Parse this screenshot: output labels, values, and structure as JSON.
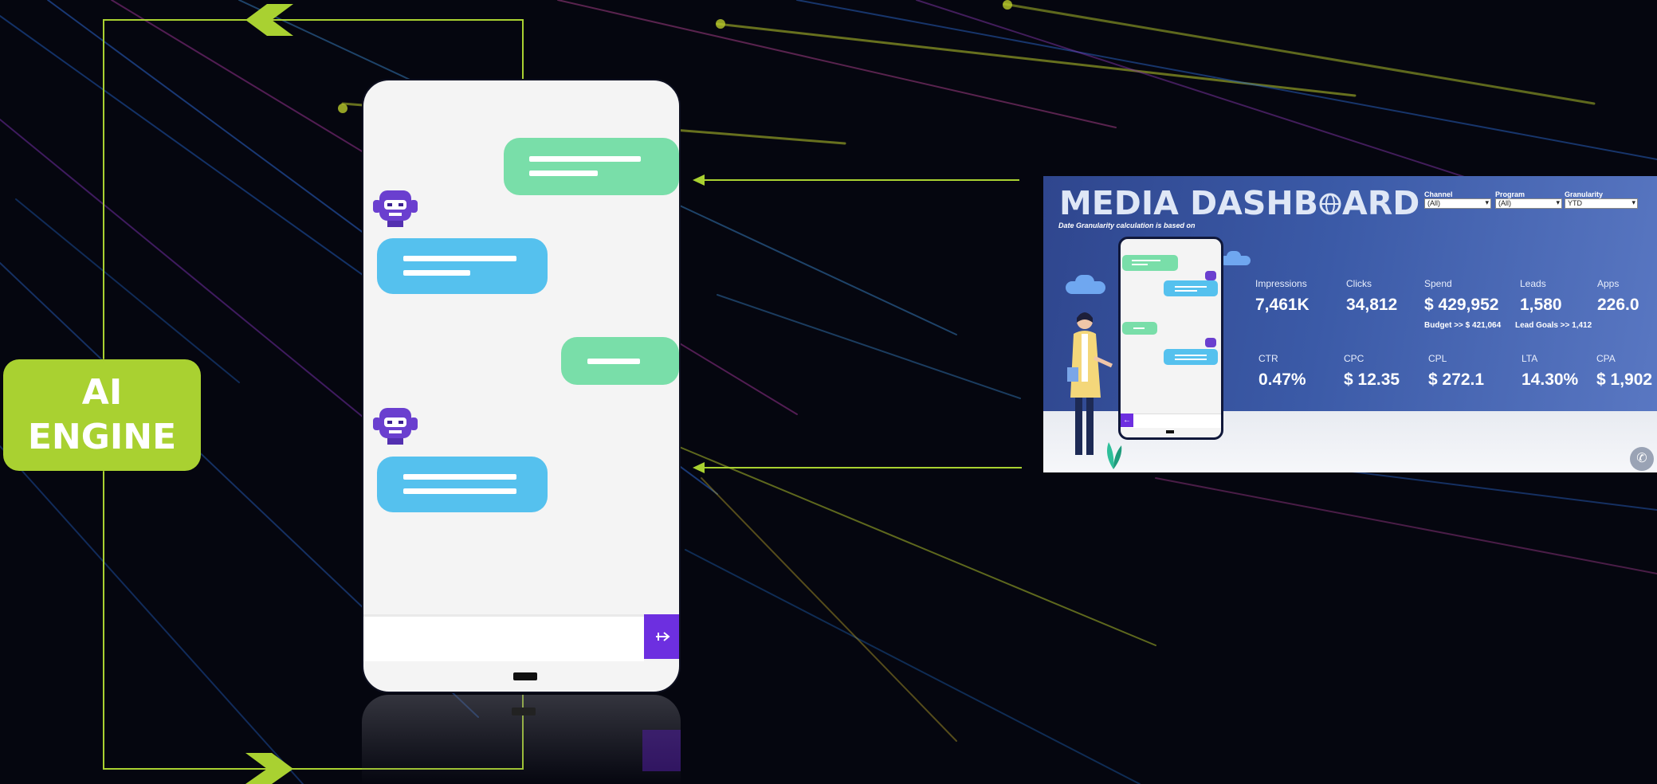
{
  "engine": {
    "line1": "AI",
    "line2": "ENGINE"
  },
  "colors": {
    "accent": "#a9d131",
    "user_bubble": "#79dea9",
    "bot_bubble": "#55c1ee",
    "send_button": "#6d2fe0",
    "bot_avatar": "#6a3fcf"
  },
  "chat": {
    "messages": [
      {
        "sender": "user"
      },
      {
        "sender": "bot"
      },
      {
        "sender": "user"
      },
      {
        "sender": "bot"
      }
    ],
    "send_icon": "arrow-right-icon",
    "bot_icon": "robot-icon"
  },
  "dashboard": {
    "title": "MEDIA DASHB",
    "title_end": "ARD",
    "title_icon": "globe-icon",
    "subtitle": "Date Granularity calculation is based on",
    "filters": [
      {
        "label": "Channel",
        "value": "(All)"
      },
      {
        "label": "Program",
        "value": "(All)"
      },
      {
        "label": "Granularity",
        "value": "YTD"
      }
    ],
    "kpis_row1": [
      {
        "label": "Impressions",
        "value": "7,461K"
      },
      {
        "label": "Clicks",
        "value": "34,812"
      },
      {
        "label": "Spend",
        "value": "$ 429,952",
        "sub": "Budget >> $ 421,064"
      },
      {
        "label": "Leads",
        "value": "1,580",
        "sub": "Lead Goals >> 1,412"
      },
      {
        "label": "Apps",
        "value": "226.0"
      }
    ],
    "kpis_row2": [
      {
        "label": "CTR",
        "value": "0.47%"
      },
      {
        "label": "CPC",
        "value": "$ 12.35"
      },
      {
        "label": "CPL",
        "value": "$ 272.1"
      },
      {
        "label": "LTA",
        "value": "14.30%"
      },
      {
        "label": "CPA",
        "value": "$ 1,902"
      }
    ],
    "chat_icon": "whatsapp-icon"
  }
}
